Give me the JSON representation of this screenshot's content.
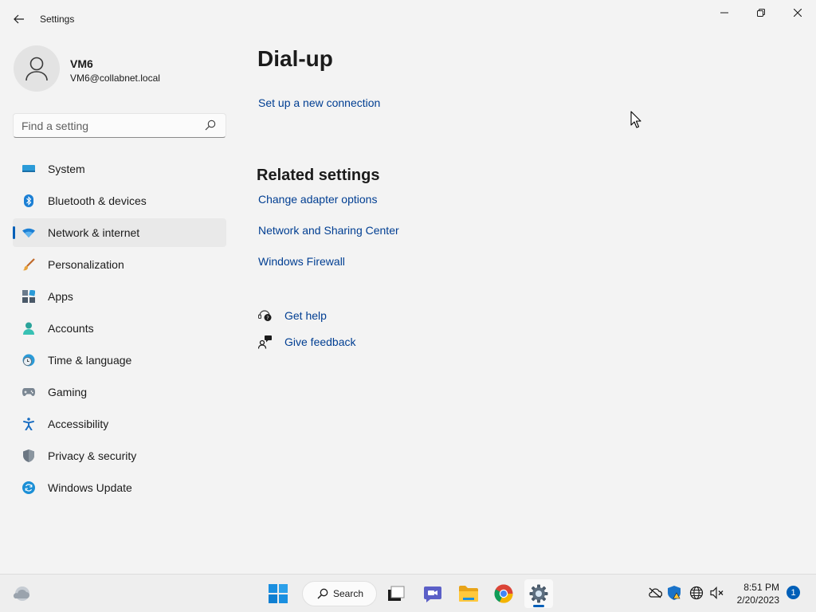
{
  "window": {
    "title": "Settings"
  },
  "profile": {
    "name": "VM6",
    "email": "VM6@collabnet.local"
  },
  "search": {
    "placeholder": "Find a setting"
  },
  "sidebar": {
    "items": [
      {
        "label": "System",
        "icon": "system-icon"
      },
      {
        "label": "Bluetooth & devices",
        "icon": "bluetooth-icon"
      },
      {
        "label": "Network & internet",
        "icon": "wifi-icon",
        "active": true
      },
      {
        "label": "Personalization",
        "icon": "brush-icon"
      },
      {
        "label": "Apps",
        "icon": "apps-icon"
      },
      {
        "label": "Accounts",
        "icon": "accounts-icon"
      },
      {
        "label": "Time & language",
        "icon": "clock-globe-icon"
      },
      {
        "label": "Gaming",
        "icon": "gamepad-icon"
      },
      {
        "label": "Accessibility",
        "icon": "accessibility-icon"
      },
      {
        "label": "Privacy & security",
        "icon": "shield-icon"
      },
      {
        "label": "Windows Update",
        "icon": "update-icon"
      }
    ]
  },
  "main": {
    "title": "Dial-up",
    "setup_link": "Set up a new connection",
    "related_title": "Related settings",
    "related_links": [
      "Change adapter options",
      "Network and Sharing Center",
      "Windows Firewall"
    ],
    "help": {
      "get_help": "Get help",
      "give_feedback": "Give feedback"
    }
  },
  "taskbar": {
    "search_label": "Search",
    "time": "8:51 PM",
    "date": "2/20/2023",
    "notification_count": "1"
  },
  "colors": {
    "accent": "#005fb8",
    "link": "#003e92",
    "background": "#f3f3f3"
  }
}
